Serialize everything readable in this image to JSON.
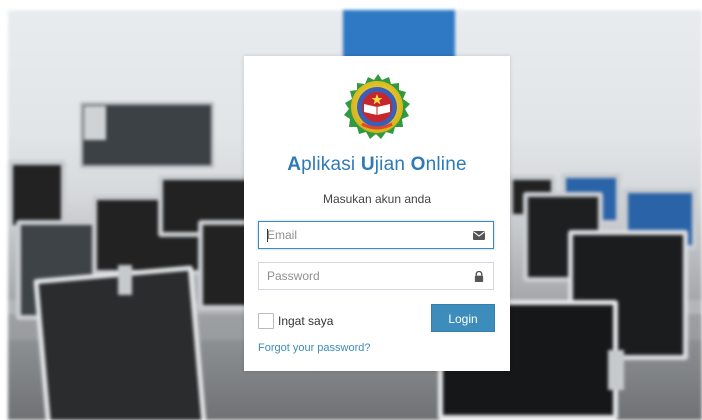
{
  "login": {
    "title_parts": {
      "a": "A",
      "a_rest": "plikasi ",
      "u": "U",
      "u_rest": "jian ",
      "o": "O",
      "o_rest": "nline"
    },
    "subtitle": "Masukan akun anda",
    "email": {
      "placeholder": "Email",
      "icon": "envelope-icon"
    },
    "password": {
      "placeholder": "Password",
      "icon": "lock-icon"
    },
    "remember_label": "Ingat saya",
    "login_label": "Login",
    "forgot_label": "Forgot your password?"
  },
  "colors": {
    "accent": "#3c8dbc",
    "title": "#2f7ab8"
  }
}
